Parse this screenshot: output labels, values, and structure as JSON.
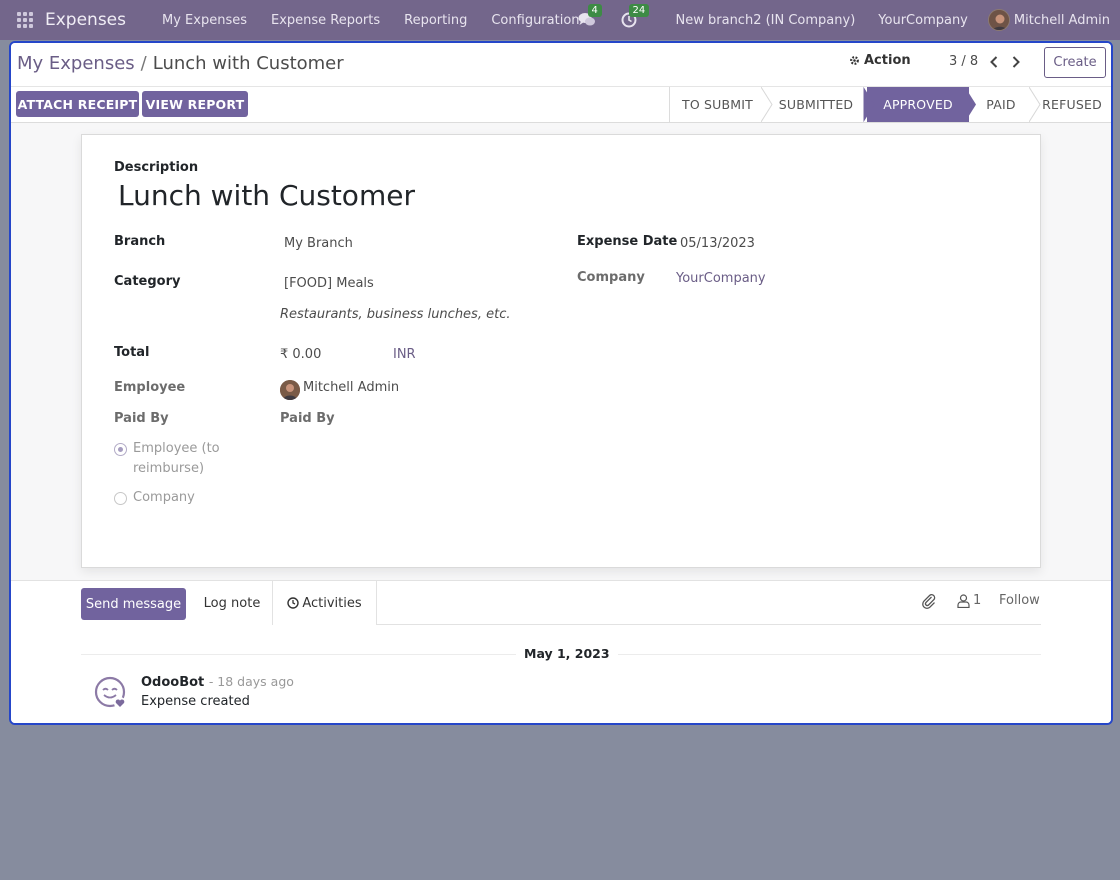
{
  "navbar": {
    "app_name": "Expenses",
    "menu": [
      "My Expenses",
      "Expense Reports",
      "Reporting",
      "Configuration"
    ],
    "messages_count": "4",
    "activities_count": "24",
    "company_switch": "New branch2 (IN Company)",
    "company": "YourCompany",
    "user": "Mitchell Admin"
  },
  "breadcrumb": {
    "parent": "My Expenses",
    "separator": "/",
    "current": "Lunch with Customer"
  },
  "control": {
    "action_label": "Action",
    "pager": "3 / 8",
    "create_label": "Create"
  },
  "statusbar": {
    "attach_receipt": "ATTACH RECEIPT",
    "view_report": "VIEW REPORT",
    "stages": [
      "TO SUBMIT",
      "SUBMITTED",
      "APPROVED",
      "PAID",
      "REFUSED"
    ],
    "active_stage": "APPROVED"
  },
  "form": {
    "description_label": "Description",
    "description": "Lunch with Customer",
    "branch_label": "Branch",
    "branch": "My Branch",
    "category_label": "Category",
    "category": "[FOOD] Meals",
    "category_note": "Restaurants, business lunches, etc.",
    "total_label": "Total",
    "total": "₹ 0.00",
    "currency": "INR",
    "employee_label": "Employee",
    "employee": "Mitchell Admin",
    "paid_by_label": "Paid By",
    "paid_by_value_label": "Paid By",
    "paid_by_options": [
      "Employee (to reimburse)",
      "Company"
    ],
    "paid_by_option_1_line1": "Employee (to",
    "paid_by_option_1_line2": "reimburse)",
    "paid_by_selected": "Employee (to reimburse)",
    "expense_date_label": "Expense Date",
    "expense_date": "05/13/2023",
    "company_label": "Company",
    "company": "YourCompany"
  },
  "chatter": {
    "send_message": "Send message",
    "log_note": "Log note",
    "activities": "Activities",
    "followers_count": "1",
    "follow": "Follow",
    "date_separator": "May 1, 2023",
    "messages": [
      {
        "author": "OdooBot",
        "date": "- 18 days ago",
        "body": "Expense created"
      }
    ]
  },
  "colors": {
    "navbar": "#73668b",
    "primary": "#71639e",
    "frame_border": "#2546c9",
    "backdrop": "#868c9e"
  }
}
